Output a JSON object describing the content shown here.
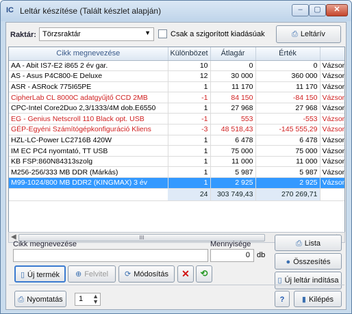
{
  "window": {
    "title": "Leltár készítése  (Talált készlet alapján)",
    "app_icon": "IC"
  },
  "toolbar": {
    "raktar_label": "Raktár:",
    "raktar_value": "Törzsraktár",
    "only_restricted_label": "Csak a szigorított kiadásúak",
    "leltariv_label": "Leltárív"
  },
  "table": {
    "headers": [
      "Cikk megnevezése",
      "Különbözet",
      "Átlagár",
      "Érték",
      ""
    ],
    "rows": [
      {
        "name": "AA - Abit IS7-E2 i865 2 év gar.",
        "diff": "10",
        "avg": "0",
        "value": "0",
        "extra": "Vázsonyin",
        "style": "normal"
      },
      {
        "name": "AS - Asus P4C800-E Deluxe",
        "diff": "12",
        "avg": "30 000",
        "value": "360 000",
        "extra": "Vázsonyin",
        "style": "normal"
      },
      {
        "name": "ASR - ASRock 775I65PE",
        "diff": "1",
        "avg": "11 170",
        "value": "11 170",
        "extra": "Vázsonyin",
        "style": "normal"
      },
      {
        "name": "CipherLab CL 8000C adatgyűjtő CCD 2MB",
        "diff": "-1",
        "avg": "84 150",
        "value": "-84 150",
        "extra": "Vázsonyin",
        "style": "red"
      },
      {
        "name": "CPC-Intel Core2Duo 2,3/1333/4M dob.E6550",
        "diff": "1",
        "avg": "27 968",
        "value": "27 968",
        "extra": "Vázsonyin",
        "style": "normal"
      },
      {
        "name": "EG - Genius Netscroll 110 Black opt. USB",
        "diff": "-1",
        "avg": "553",
        "value": "-553",
        "extra": "Vázsonyin",
        "style": "red"
      },
      {
        "name": "GÉP-Egyéni Számítógépkonfiguráció Kliens",
        "diff": "-3",
        "avg": "48 518,43",
        "value": "-145 555,29",
        "extra": "Vázsonyin",
        "style": "red"
      },
      {
        "name": "HZL-LC-Power LC2716B 420W",
        "diff": "1",
        "avg": "6 478",
        "value": "6 478",
        "extra": "Vázsonyin",
        "style": "normal"
      },
      {
        "name": "IM EC PC4 nyomtató, TT USB",
        "diff": "1",
        "avg": "75 000",
        "value": "75 000",
        "extra": "Vázsonyin",
        "style": "normal"
      },
      {
        "name": "KB FSP:860N84313szolg",
        "diff": "1",
        "avg": "11 000",
        "value": "11 000",
        "extra": "Vázsonyin",
        "style": "normal"
      },
      {
        "name": "M256-256/333 MB DDR (Márkás)",
        "diff": "1",
        "avg": "5 987",
        "value": "5 987",
        "extra": "Vázsonyin",
        "style": "normal"
      },
      {
        "name": "M99-1024/800 MB DDR2 (KINGMAX) 3 év",
        "diff": "1",
        "avg": "2 925",
        "value": "2 925",
        "extra": "Vázsonyin",
        "style": "selected"
      }
    ],
    "totals": {
      "diff": "24",
      "avg": "303 749,43",
      "value": "270 269,71"
    },
    "scrollbar_grip": "III"
  },
  "form": {
    "cikk_label": "Cikk megnevezése",
    "cikk_value": "",
    "mennyiseg_label": "Mennyisége",
    "mennyiseg_value": "0",
    "unit": "db"
  },
  "actions": {
    "uj_termek": "Új termék",
    "felvitel": "Felvitel",
    "modositas": "Módosítás",
    "lista": "Lista",
    "osszesites": "Összesítés",
    "uj_leltar": "Új leltár indítása"
  },
  "footer": {
    "nyomtatas": "Nyomtatás",
    "copies": "1",
    "help": "?",
    "kilepes": "Kilépés"
  },
  "colors": {
    "selection": "#3399ff",
    "negative_row": "#d02020",
    "titlebar": "#c9dced"
  }
}
